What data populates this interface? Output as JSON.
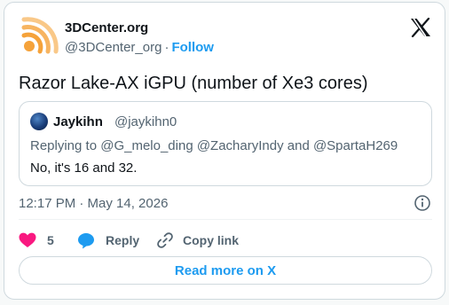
{
  "author": {
    "name": "3DCenter.org",
    "handle": "@3DCenter_org",
    "separator": "·",
    "follow_label": "Follow",
    "avatar_icon": "wifi-signal-logo"
  },
  "tweet": {
    "text": "Razor Lake-AX iGPU (number of Xe3 cores)",
    "timestamp": "12:17 PM · May 14, 2026"
  },
  "quote": {
    "name": "Jaykihn",
    "handle": "@jaykihn0",
    "replying_to": "Replying to @G_melo_ding @ZacharyIndy and @SpartaH269",
    "text": "No, it's 16 and 32."
  },
  "actions": {
    "like_count": "5",
    "reply_label": "Reply",
    "copy_label": "Copy link"
  },
  "read_more_label": "Read more on X",
  "colors": {
    "accent": "#1d9bf0",
    "like": "#f91880",
    "logo_orange": "#f5a23a",
    "muted": "#536471"
  }
}
